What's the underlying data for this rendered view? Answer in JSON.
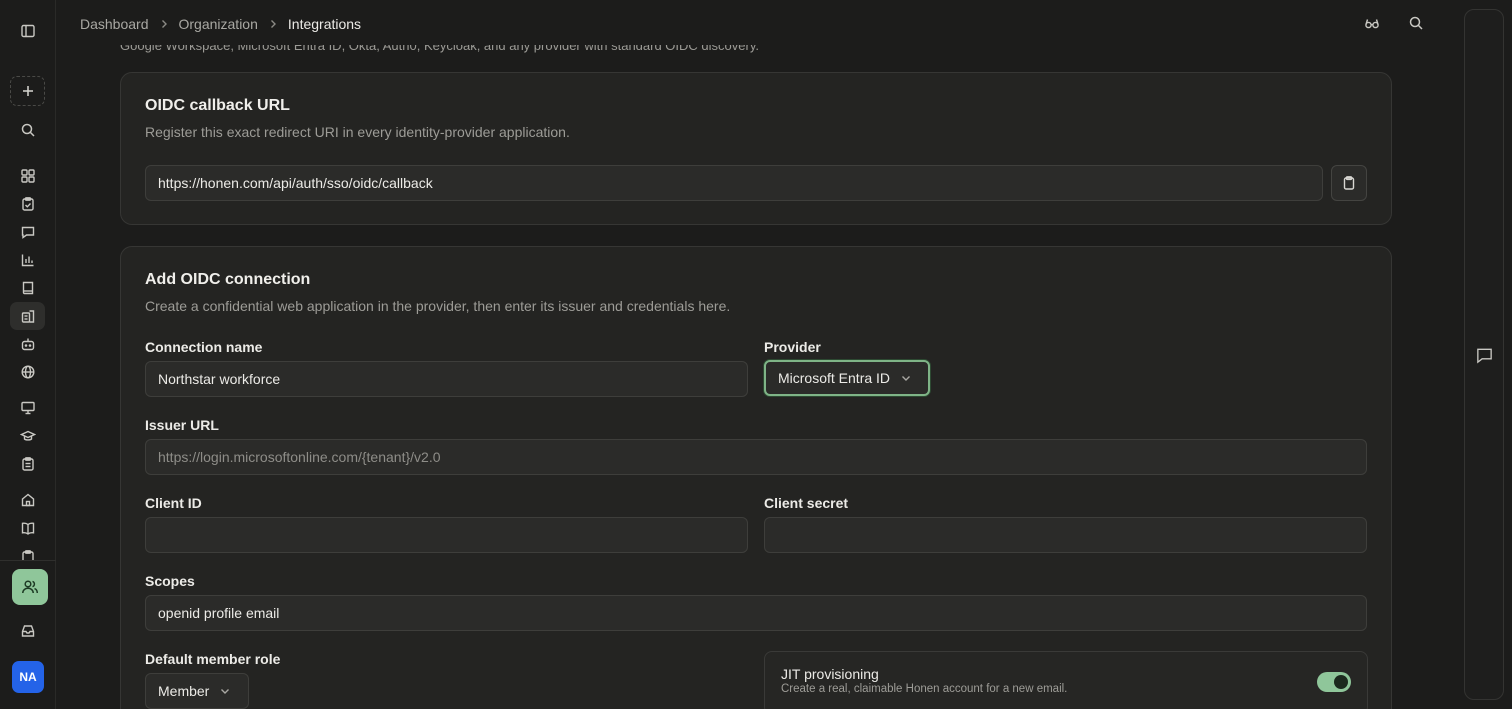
{
  "breadcrumb": {
    "items": [
      "Dashboard",
      "Organization"
    ],
    "current": "Integrations"
  },
  "intro_text": "Google Workspace, Microsoft Entra ID, Okta, Auth0, Keycloak, and any provider with standard OIDC discovery.",
  "callback_card": {
    "title": "OIDC callback URL",
    "subtitle": "Register this exact redirect URI in every identity-provider application.",
    "url": "https://honen.com/api/auth/sso/oidc/callback"
  },
  "connection_card": {
    "title": "Add OIDC connection",
    "subtitle": "Create a confidential web application in the provider, then enter its issuer and credentials here.",
    "connection_name_label": "Connection name",
    "connection_name_value": "Northstar workforce",
    "provider_label": "Provider",
    "provider_value": "Microsoft Entra ID",
    "issuer_label": "Issuer URL",
    "issuer_placeholder": "https://login.microsoftonline.com/{tenant}/v2.0",
    "client_id_label": "Client ID",
    "client_id_value": "",
    "client_secret_label": "Client secret",
    "client_secret_value": "",
    "scopes_label": "Scopes",
    "scopes_value": "openid profile email",
    "default_role_label": "Default member role",
    "default_role_value": "Member",
    "jit": {
      "title": "JIT provisioning",
      "subtitle": "Create a real, claimable Honen account for a new email.",
      "enabled": true
    }
  },
  "user": {
    "initials": "NA"
  },
  "colors": {
    "accent": "#8fc69a",
    "avatar": "#2463e8",
    "background": "#1c1c1b",
    "card": "#242422"
  }
}
